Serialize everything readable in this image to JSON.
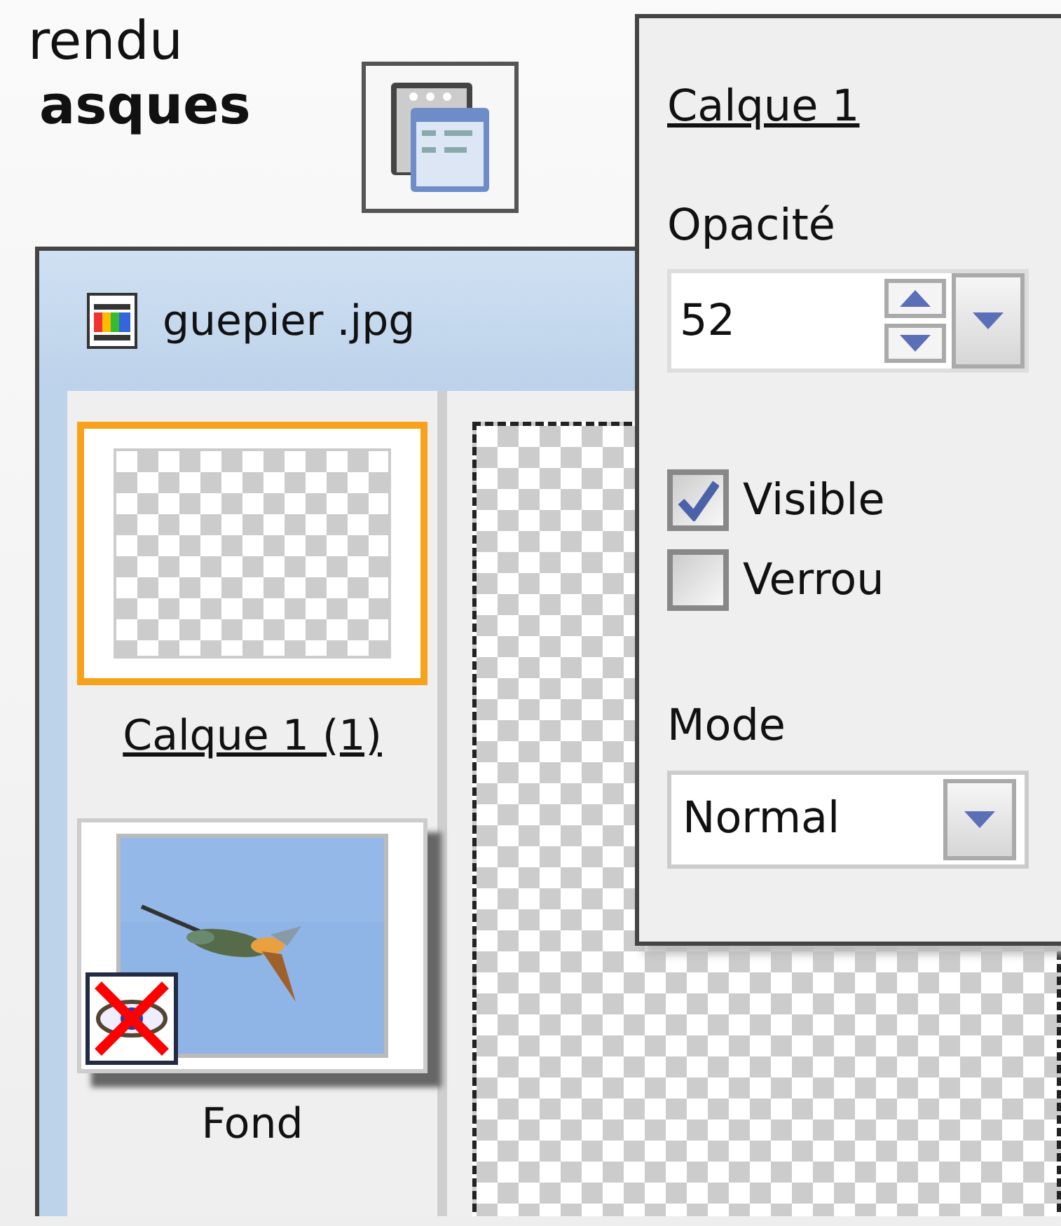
{
  "intro_text": [
    {
      "text": "rendu",
      "bold": false
    },
    {
      "text": "asques",
      "bold": true
    }
  ],
  "document_window": {
    "title": "guepier .jpg",
    "layers": [
      {
        "name": "Calque 1 (1)",
        "kind": "transparent",
        "selected": true,
        "visible": true
      },
      {
        "name": "Fond",
        "kind": "picture",
        "selected": false,
        "visible": false
      }
    ]
  },
  "layer_properties": {
    "title": "Calque 1",
    "opacity_label": "Opacité",
    "opacity": "52",
    "checkboxes": [
      {
        "label": "Visible",
        "checked": true
      },
      {
        "label": "Verrou",
        "checked": false
      }
    ],
    "mode_label": "Mode",
    "mode": "Normal"
  }
}
